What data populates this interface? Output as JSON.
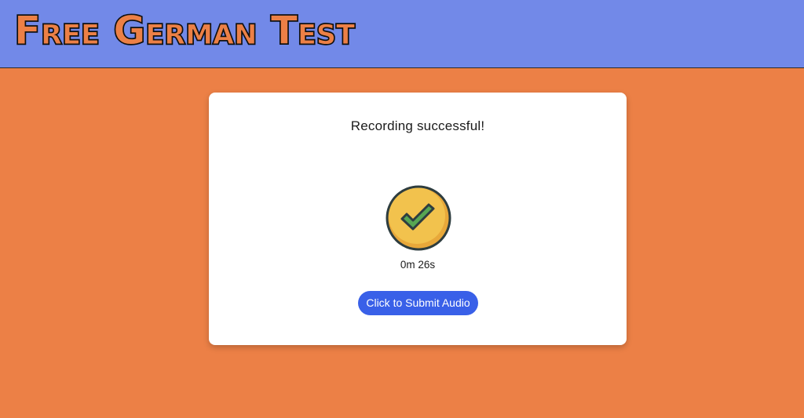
{
  "header": {
    "title": "Free German Test",
    "background_color": "#7289e8"
  },
  "page": {
    "background_color": "#ec8046"
  },
  "card": {
    "status_text": "Recording successful!",
    "status_icon": "check-circle-icon",
    "elapsed_time": "0m 26s",
    "submit_label": "Click to Submit Audio",
    "submit_color": "#3960e8"
  }
}
